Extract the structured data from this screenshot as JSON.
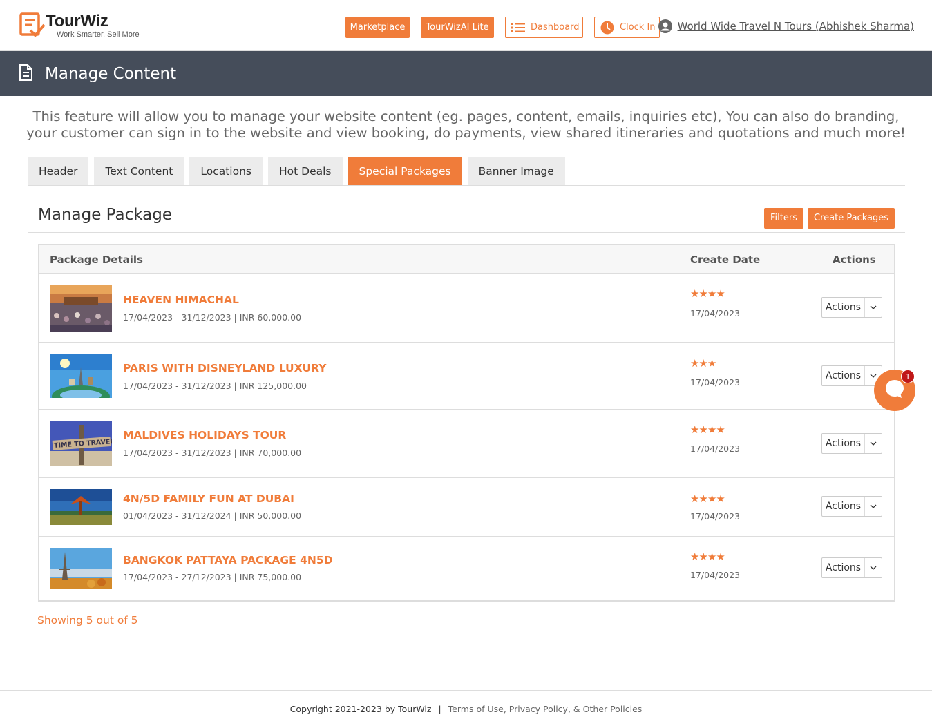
{
  "brand": {
    "name": "TourWiz",
    "tagline": "Work Smarter, Sell More",
    "accent": "#f07c3a",
    "header_bg": "#454d5a"
  },
  "nav": {
    "marketplace": "Marketplace",
    "tourwizai": "TourWizAI Lite",
    "dashboard": "Dashboard",
    "clock_in": "Clock In",
    "user": "World Wide Travel N Tours (Abhishek Sharma)"
  },
  "page": {
    "title": "Manage Content",
    "intro": "This feature will allow you to manage your website content (eg. pages, content, emails, inquiries etc), You can also do branding, your customer can sign in to the website and view booking, do payments, view shared itineraries and quotations and much more!"
  },
  "tabs": [
    {
      "label": "Header",
      "active": false
    },
    {
      "label": "Text Content",
      "active": false
    },
    {
      "label": "Locations",
      "active": false
    },
    {
      "label": "Hot Deals",
      "active": false
    },
    {
      "label": "Special Packages",
      "active": true
    },
    {
      "label": "Banner Image",
      "active": false
    }
  ],
  "section": {
    "title": "Manage Package",
    "filters": "Filters",
    "create": "Create Packages"
  },
  "table": {
    "columns": {
      "details": "Package Details",
      "date": "Create Date",
      "actions": "Actions"
    },
    "rows": [
      {
        "name": "HEAVEN HIMACHAL",
        "meta": "17/04/2023 - 31/12/2023 | INR 60,000.00",
        "stars": "★★★★",
        "rating": 4,
        "date": "17/04/2023",
        "action": "Actions"
      },
      {
        "name": "PARIS WITH DISNEYLAND LUXURY",
        "meta": "17/04/2023 - 31/12/2023 | INR 125,000.00",
        "stars": "★★★",
        "rating": 3,
        "date": "17/04/2023",
        "action": "Actions"
      },
      {
        "name": "MALDIVES HOLIDAYS TOUR",
        "meta": "17/04/2023 - 31/12/2023 | INR 70,000.00",
        "stars": "★★★★",
        "rating": 4,
        "date": "17/04/2023",
        "action": "Actions"
      },
      {
        "name": "4N/5D FAMILY FUN AT DUBAI",
        "meta": "01/04/2023 - 31/12/2024 | INR 50,000.00",
        "stars": "★★★★",
        "rating": 4,
        "date": "17/04/2023",
        "action": "Actions"
      },
      {
        "name": "BANGKOK PATTAYA PACKAGE 4N5D",
        "meta": "17/04/2023 - 27/12/2023 | INR 75,000.00",
        "stars": "★★★★",
        "rating": 4,
        "date": "17/04/2023",
        "action": "Actions"
      }
    ]
  },
  "thumbs": {
    "maldives_sign": "TIME TO TRAVEL"
  },
  "showing": "Showing 5 out of 5",
  "footer": {
    "copyright": "Copyright 2021-2023 by TourWiz",
    "separator": "|",
    "links": "Terms of Use, Privacy Policy, & Other Policies"
  },
  "chat": {
    "badge": "1"
  }
}
